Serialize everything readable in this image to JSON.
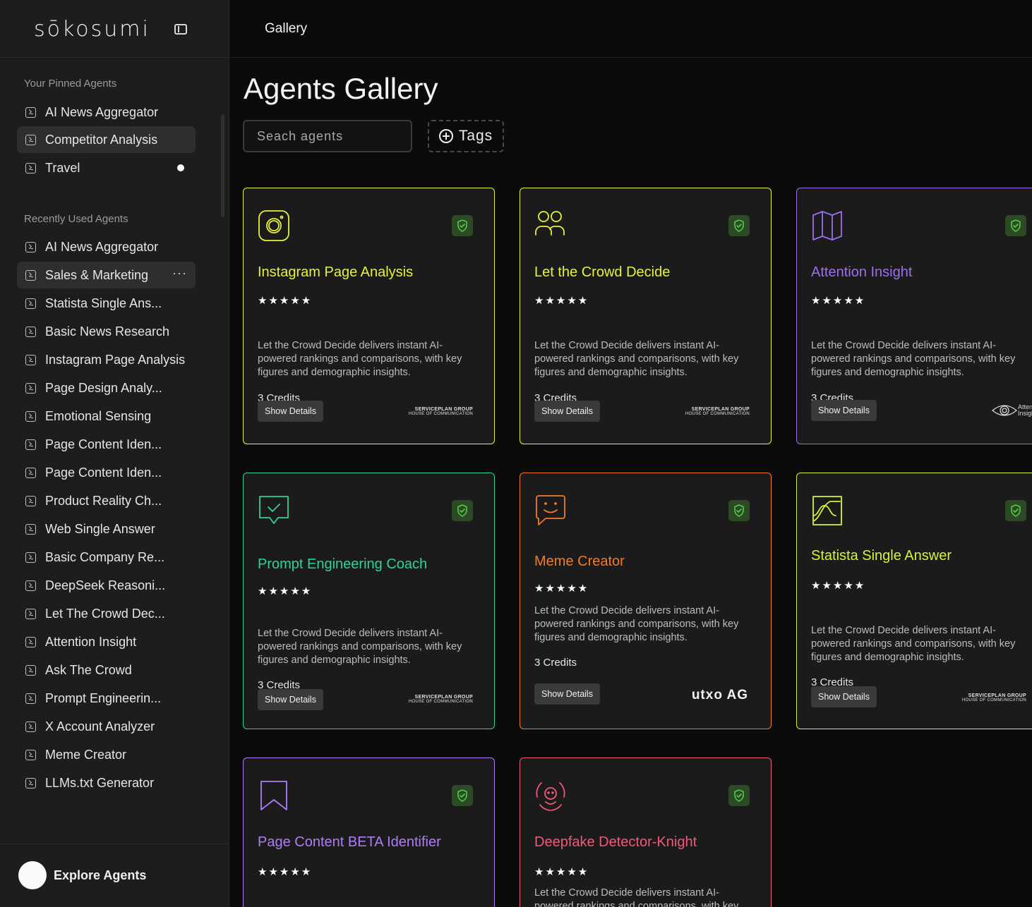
{
  "app": {
    "logo": "sōkosumi"
  },
  "header": {
    "breadcrumb": "Gallery"
  },
  "sidebar": {
    "pinned_title": "Your Pinned Agents",
    "pinned": [
      {
        "label": "AI News Aggregator"
      },
      {
        "label": "Competitor Analysis"
      },
      {
        "label": "Travel"
      }
    ],
    "recent_title": "Recently Used Agents",
    "recent": [
      {
        "label": "AI News Aggregator"
      },
      {
        "label": "Sales & Marketing"
      },
      {
        "label": "Statista Single Ans..."
      },
      {
        "label": "Basic News Research"
      },
      {
        "label": "Instagram Page Analysis"
      },
      {
        "label": "Page Design Analy..."
      },
      {
        "label": "Emotional Sensing"
      },
      {
        "label": "Page Content Iden..."
      },
      {
        "label": "Page Content Iden..."
      },
      {
        "label": "Product Reality Ch..."
      },
      {
        "label": "Web Single Answer"
      },
      {
        "label": "Basic Company Re..."
      },
      {
        "label": "DeepSeek Reasoni..."
      },
      {
        "label": "Let The Crowd Dec..."
      },
      {
        "label": "Attention Insight"
      },
      {
        "label": "Ask The Crowd"
      },
      {
        "label": "Prompt Engineerin..."
      },
      {
        "label": "X Account Analyzer"
      },
      {
        "label": "Meme Creator"
      },
      {
        "label": "LLMs.txt Generator"
      }
    ],
    "more_label": "···",
    "explore_label": "Explore Agents"
  },
  "main": {
    "title": "Agents Gallery",
    "search_placeholder": "Seach agents",
    "tags_label": "Tags",
    "cards": [
      {
        "name": "Instagram Page Analysis",
        "color": "#e7f23a",
        "icon": "instagram-icon",
        "stars": "★★★★★",
        "desc": "Let the Crowd Decide delivers instant AI-powered rankings and comparisons, with key figures and demographic insights.",
        "credits": "3 Credits",
        "details": "Show Details",
        "brand": "SERVICEPLAN GROUP",
        "brand_sub": "HOUSE OF COMMUNICATION"
      },
      {
        "name": "Let the Crowd Decide",
        "color": "#e7f23a",
        "icon": "users-icon",
        "stars": "★★★★★",
        "desc": "Let the Crowd Decide delivers instant AI-powered rankings and comparisons, with key figures and demographic insights.",
        "credits": "3 Credits",
        "details": "Show Details",
        "brand": "SERVICEPLAN GROUP",
        "brand_sub": "HOUSE OF COMMUNICATION"
      },
      {
        "name": "Attention Insight",
        "color": "#9c6ef0",
        "icon": "map-icon",
        "stars": "★★★★★",
        "desc": "Let the Crowd Decide delivers instant AI-powered rankings and comparisons, with key figures and demographic insights.",
        "credits": "3 Credits",
        "details": "Show Details",
        "brand": "Attention Insight"
      },
      {
        "name": "Prompt Engineering Coach",
        "color": "#2fd39a",
        "icon": "chat-check-icon",
        "stars": "★★★★★",
        "desc": "Let the Crowd Decide delivers instant AI-powered rankings and comparisons, with key figures and demographic insights.",
        "credits": "3 Credits",
        "details": "Show Details",
        "brand": "SERVICEPLAN GROUP",
        "brand_sub": "HOUSE OF COMMUNICATION"
      },
      {
        "name": "Meme Creator",
        "color": "#f47a2a",
        "icon": "smile-chat-icon",
        "stars": "★★★★★",
        "desc": "Let the Crowd Decide delivers instant AI-powered rankings and comparisons, with key figures and demographic insights.",
        "credits": "3 Credits",
        "details": "Show Details",
        "brand": "utxo AG"
      },
      {
        "name": "Statista Single Answer",
        "color": "#d8f23a",
        "icon": "chart-icon",
        "stars": "★★★★★",
        "desc": "Let the Crowd Decide delivers instant AI-powered rankings and comparisons, with key figures and demographic insights.",
        "credits": "3 Credits",
        "details": "Show Details",
        "brand": "SERVICEPLAN GROUP",
        "brand_sub": "HOUSE OF COMMUNICATION"
      },
      {
        "name": "Page Content BETA Identifier",
        "color": "#b07cf5",
        "icon": "bookmark-icon",
        "stars": "★★★★★"
      },
      {
        "name": "Deepfake Detector-Knight",
        "color": "#f2587a",
        "icon": "face-scan-icon",
        "stars": "★★★★★",
        "desc": "Let the Crowd Decide delivers instant AI-powered rankings and comparisons, with key figures and demographic insights."
      }
    ]
  }
}
